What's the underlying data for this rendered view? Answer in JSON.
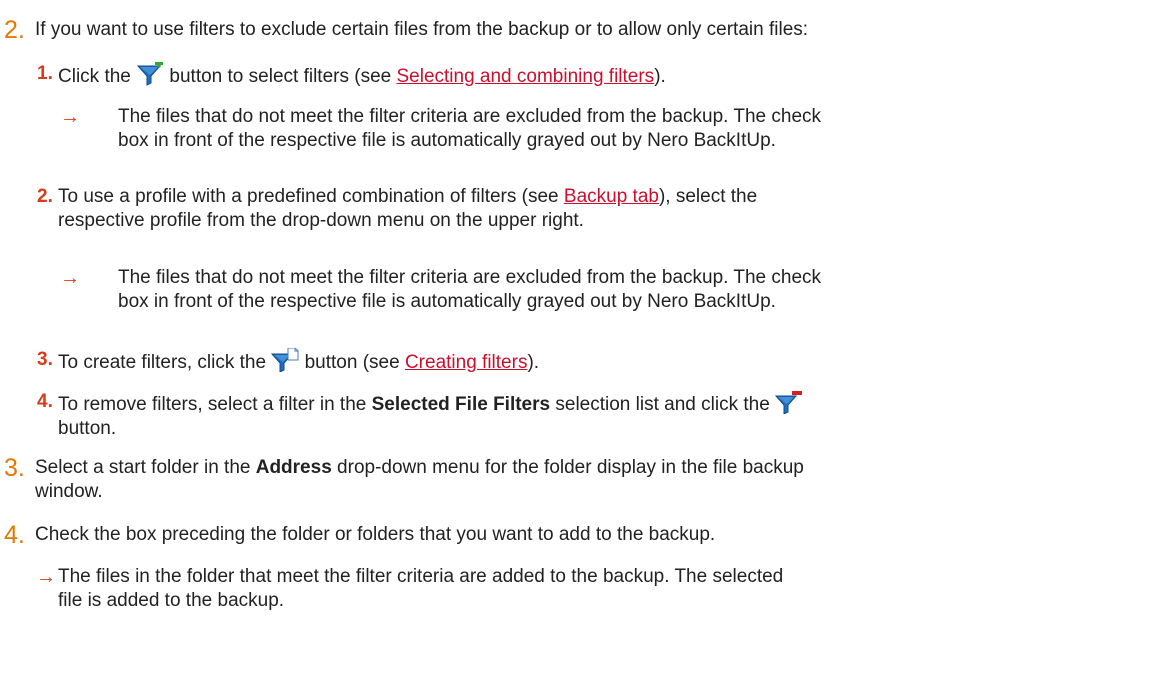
{
  "step2": {
    "number": "2.",
    "text": "If you want to use filters to exclude certain files from the backup or to allow only certain files:",
    "sub1": {
      "number": "1.",
      "before": "Click the",
      "after": "button to select filters (see",
      "link": "Selecting and combining filters",
      "end": ").",
      "result_line1": "The files that do not meet the filter criteria are excluded from the backup. The check",
      "result_line2": "box in front of the respective file is automatically grayed out by Nero BackItUp."
    },
    "sub2": {
      "number": "2.",
      "line1_before": "To use a profile with a predefined combination of filters (see",
      "link": "Backup tab",
      "line1_after": "), select the",
      "line2": "respective profile from the drop-down menu on the upper right.",
      "result_line1": "The files that do not meet the filter criteria are excluded from the backup. The check",
      "result_line2": "box in front of the respective file is automatically grayed out by Nero BackItUp."
    },
    "sub3": {
      "number": "3.",
      "before": "To create filters, click the",
      "after": "button (see",
      "link": "Creating filters",
      "end": ")."
    },
    "sub4": {
      "number": "4.",
      "before": "To remove filters, select a filter in the",
      "bold": "Selected File Filters",
      "after": "selection list and click the",
      "line2": "button."
    }
  },
  "step3": {
    "number": "3.",
    "before": "Select a start folder in the",
    "bold": "Address",
    "after": "drop-down menu for the folder display in the file backup",
    "line2": "window."
  },
  "step4": {
    "number": "4.",
    "text": "Check the box preceding the folder or folders that you want to add to the backup.",
    "result_line1": "The files in the folder that meet the filter criteria are added to the backup. The selected",
    "result_line2": "file is added to the backup."
  },
  "arrow_glyph": "→",
  "icons": {
    "add": "filter-add-icon",
    "new": "filter-new-icon",
    "remove": "filter-remove-icon"
  },
  "colors": {
    "main_number": "#e07a00",
    "sub_number": "#d63c1a",
    "link": "#c8102e",
    "funnel": "#1f6fc2"
  }
}
